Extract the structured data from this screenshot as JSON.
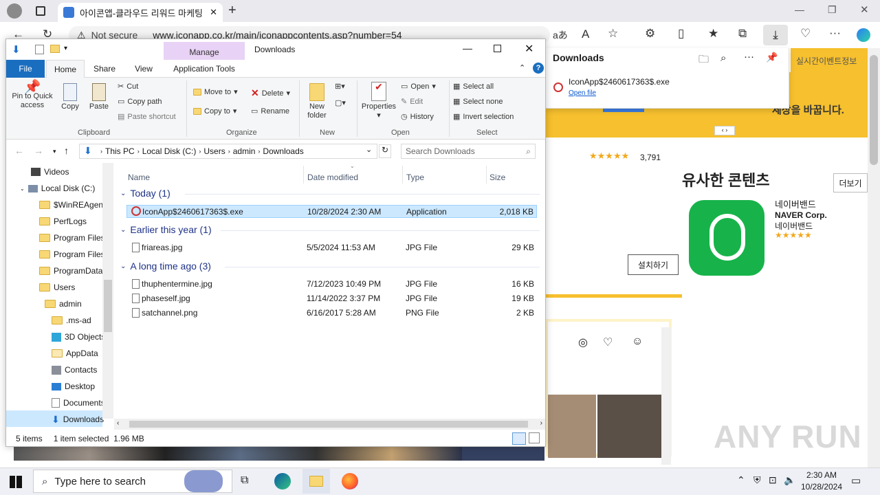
{
  "browser": {
    "tab_title": "아이콘앱-클라우드 리워드 마케팅",
    "not_secure": "Not secure",
    "url": "www.iconapp.co.kr/main/iconappcontents.asp?number=54",
    "banner_text": "실시간이벤트정보"
  },
  "downloads": {
    "title": "Downloads",
    "file": "IconApp$2460617363$.exe",
    "open_file": "Open file"
  },
  "explorer": {
    "manage": "Manage",
    "title": "Downloads",
    "tabs": [
      "File",
      "Home",
      "Share",
      "View",
      "Application Tools"
    ],
    "ribbon": {
      "pin": "Pin to Quick access",
      "copy": "Copy",
      "paste": "Paste",
      "cut": "Cut",
      "copy_path": "Copy path",
      "paste_shortcut": "Paste shortcut",
      "clipboard": "Clipboard",
      "move_to": "Move to",
      "copy_to": "Copy to",
      "delete": "Delete",
      "rename": "Rename",
      "organize": "Organize",
      "new_folder": "New folder",
      "new": "New",
      "properties": "Properties",
      "open": "Open",
      "edit": "Edit",
      "history": "History",
      "open_group": "Open",
      "select_all": "Select all",
      "select_none": "Select none",
      "invert_selection": "Invert selection",
      "select": "Select"
    },
    "breadcrumb": [
      "This PC",
      "Local Disk (C:)",
      "Users",
      "admin",
      "Downloads"
    ],
    "search_placeholder": "Search Downloads",
    "tree": [
      "Videos",
      "Local Disk (C:)",
      "$WinREAgent",
      "PerfLogs",
      "Program Files",
      "Program Files",
      "ProgramData",
      "Users",
      "admin",
      ".ms-ad",
      "3D Objects",
      "AppData",
      "Contacts",
      "Desktop",
      "Documents",
      "Downloads"
    ],
    "columns": {
      "name": "Name",
      "date": "Date modified",
      "type": "Type",
      "size": "Size"
    },
    "groups": [
      {
        "label": "Today (1)",
        "files": [
          {
            "name": "IconApp$2460617363$.exe",
            "date": "10/28/2024 2:30 AM",
            "type": "Application",
            "size": "2,018 KB"
          }
        ]
      },
      {
        "label": "Earlier this year (1)",
        "files": [
          {
            "name": "friareas.jpg",
            "date": "5/5/2024 11:53 AM",
            "type": "JPG File",
            "size": "29 KB"
          }
        ]
      },
      {
        "label": "A long time ago (3)",
        "files": [
          {
            "name": "thuphentermine.jpg",
            "date": "7/12/2023 10:49 PM",
            "type": "JPG File",
            "size": "16 KB"
          },
          {
            "name": "phaseself.jpg",
            "date": "11/14/2022 3:37 PM",
            "type": "JPG File",
            "size": "19 KB"
          },
          {
            "name": "satchannel.png",
            "date": "6/16/2017 5:28 AM",
            "type": "PNG File",
            "size": "2 KB"
          }
        ]
      }
    ],
    "status": {
      "items": "5 items",
      "selected": "1 item selected  1.96 MB"
    }
  },
  "webpage": {
    "rating_count": "3,791",
    "similar": "유사한 콘텐츠",
    "more": "더보기",
    "install": "설치하기",
    "app_name": "네이버밴드",
    "app_company": "NAVER Corp.",
    "app_name2": "네이버밴드",
    "banner_word": "세상을 바꿉니다."
  },
  "taskbar": {
    "search": "Type here to search",
    "time": "2:30 AM",
    "date": "10/28/2024"
  },
  "watermark": "ANY RUN"
}
